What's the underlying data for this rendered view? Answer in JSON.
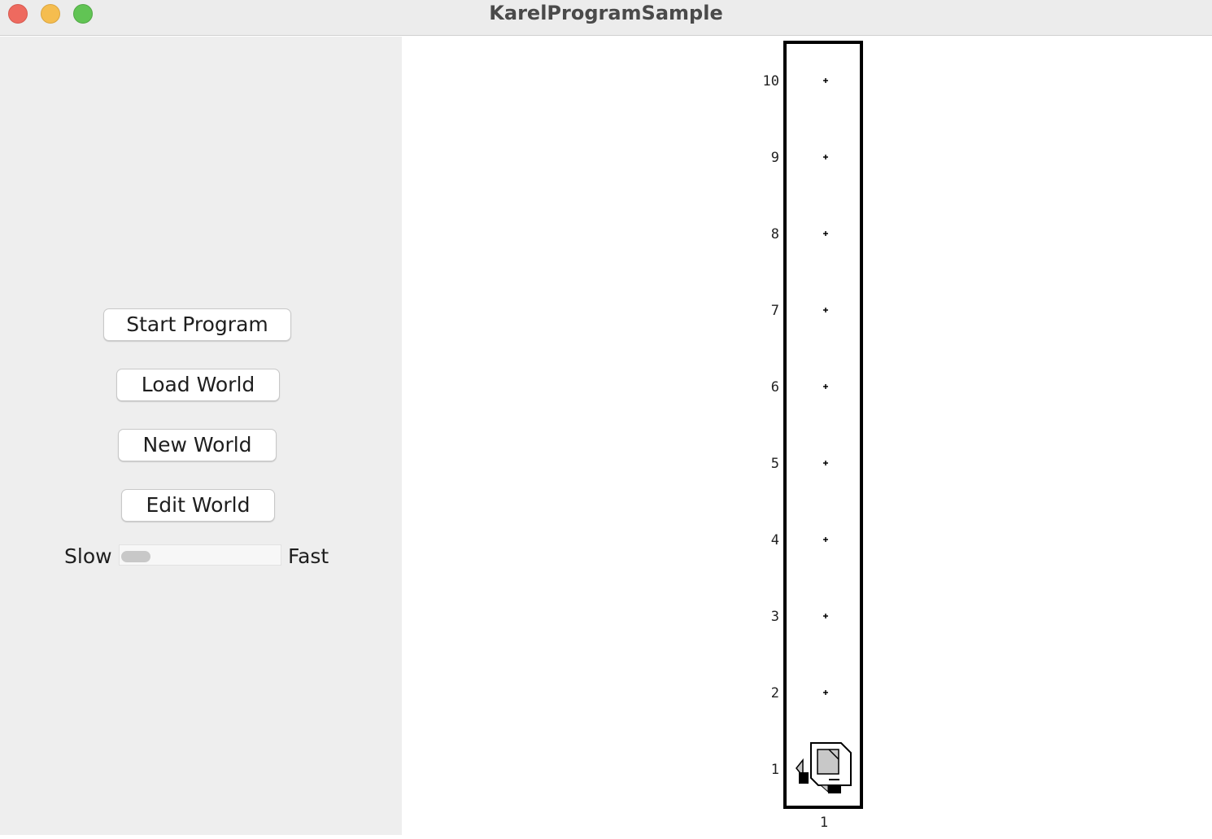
{
  "window": {
    "title": "KarelProgramSample",
    "controls": [
      "close",
      "minimize",
      "maximize"
    ]
  },
  "control_panel": {
    "buttons": {
      "start": "Start Program",
      "load": "Load World",
      "new": "New World",
      "edit": "Edit World"
    },
    "speed": {
      "slow_label": "Slow",
      "fast_label": "Fast",
      "value": 0.0
    }
  },
  "world": {
    "columns": 1,
    "rows": 10,
    "row_labels": [
      "10",
      "9",
      "8",
      "7",
      "6",
      "5",
      "4",
      "3",
      "2",
      "1"
    ],
    "column_labels": [
      "1"
    ],
    "karel": {
      "icon": "karel-robot-icon",
      "avenue": 1,
      "street": 1,
      "facing": "east"
    }
  }
}
